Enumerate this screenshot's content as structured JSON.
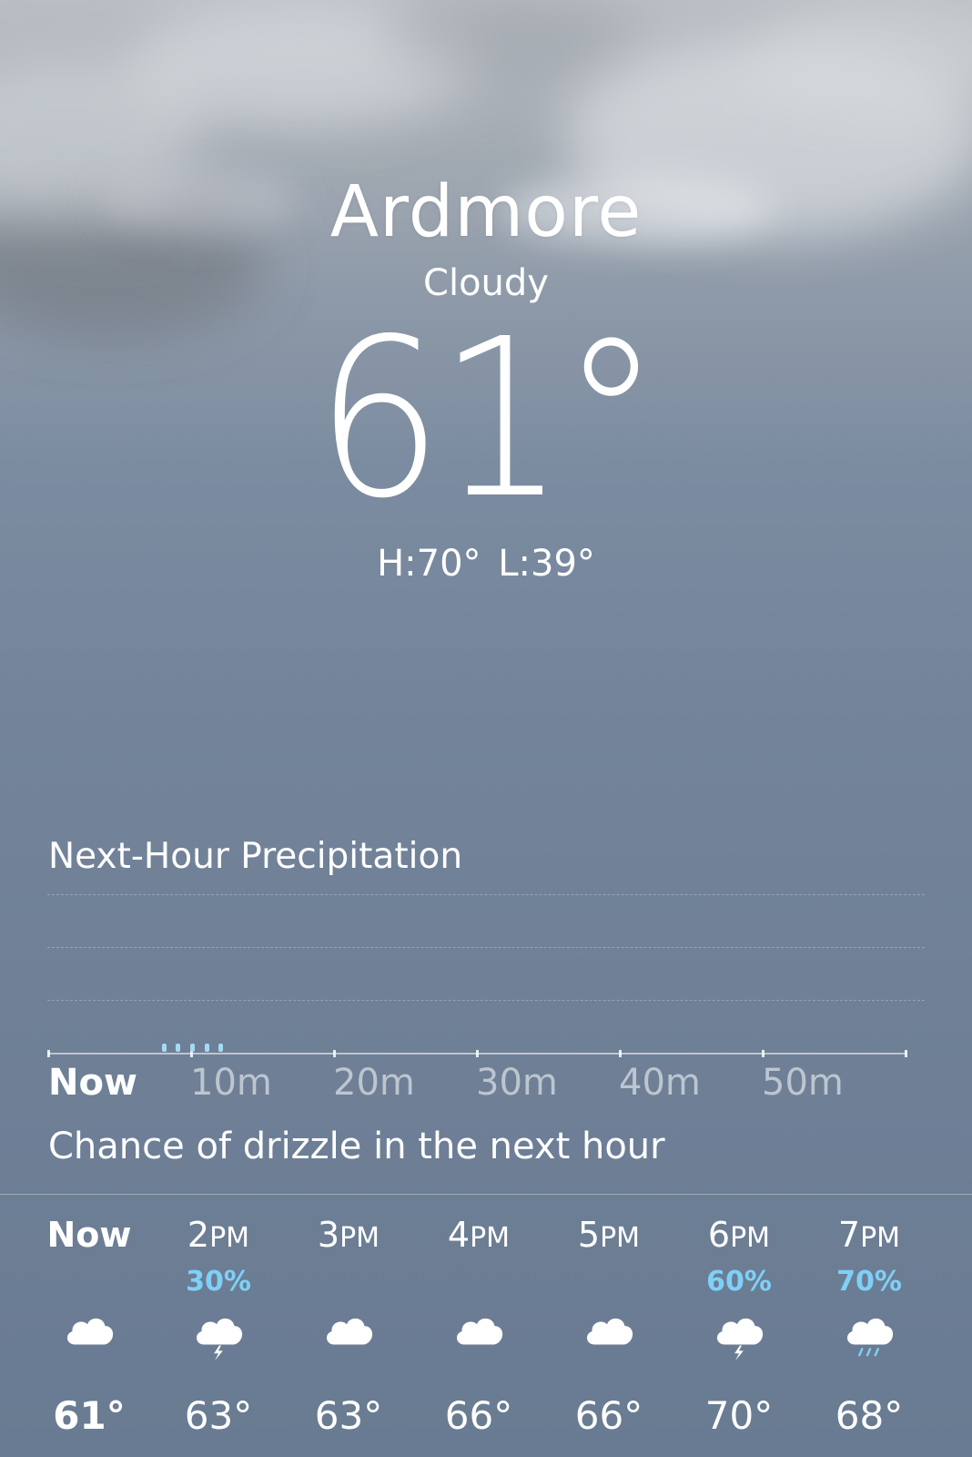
{
  "location": {
    "city": "Ardmore",
    "condition": "Cloudy",
    "temperature": "61°",
    "high_low": "H:70°  L:39°"
  },
  "precipitation": {
    "title": "Next-Hour Precipitation",
    "axis_labels": [
      "Now",
      "10m",
      "20m",
      "30m",
      "40m",
      "50m"
    ],
    "summary": "Chance of drizzle in the next hour",
    "drizzle_minutes": [
      8,
      9,
      10,
      11,
      12
    ]
  },
  "hourly": [
    {
      "time": "Now",
      "ampm": "",
      "pop": "",
      "icon": "cloud-icon",
      "temp": "61°"
    },
    {
      "time": "2",
      "ampm": "PM",
      "pop": "30%",
      "icon": "cloud-lightning-icon",
      "temp": "63°"
    },
    {
      "time": "3",
      "ampm": "PM",
      "pop": "",
      "icon": "cloud-icon",
      "temp": "63°"
    },
    {
      "time": "4",
      "ampm": "PM",
      "pop": "",
      "icon": "cloud-icon",
      "temp": "66°"
    },
    {
      "time": "5",
      "ampm": "PM",
      "pop": "",
      "icon": "cloud-icon",
      "temp": "66°"
    },
    {
      "time": "6",
      "ampm": "PM",
      "pop": "60%",
      "icon": "cloud-lightning-icon",
      "temp": "70°"
    },
    {
      "time": "7",
      "ampm": "PM",
      "pop": "70%",
      "icon": "cloud-rain-icon",
      "temp": "68°"
    }
  ],
  "colors": {
    "precip_accent": "#7fd0f7",
    "text": "#ffffff"
  }
}
